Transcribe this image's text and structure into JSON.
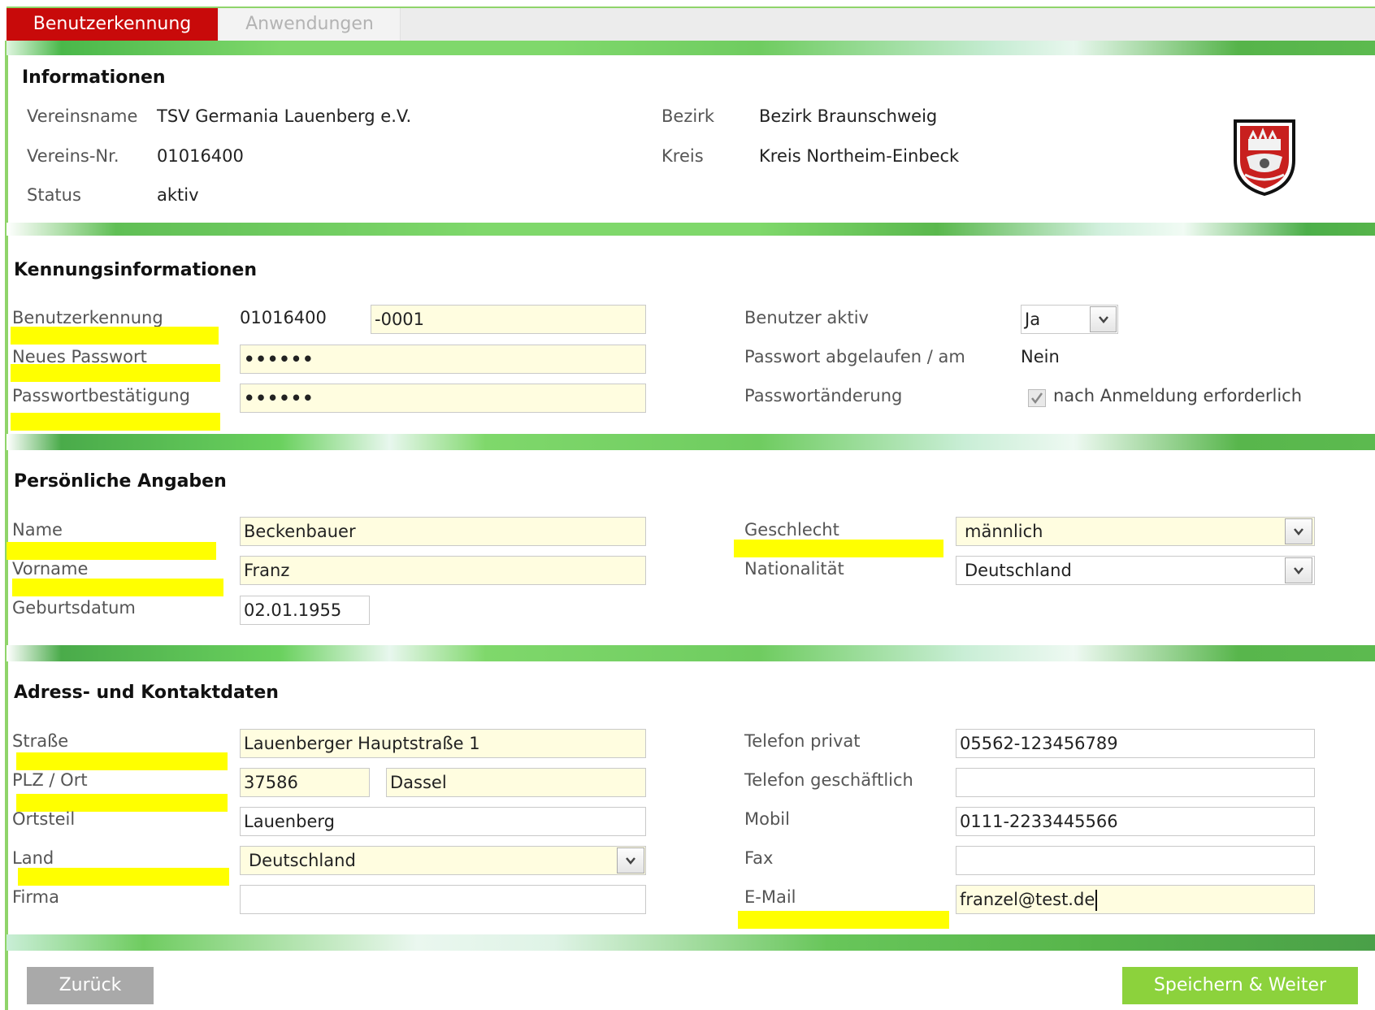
{
  "tabs": [
    {
      "label": "Benutzerkennung",
      "active": true
    },
    {
      "label": "Anwendungen",
      "active": false
    }
  ],
  "info": {
    "title": "Informationen",
    "vereinsname_label": "Vereinsname",
    "vereinsname": "TSV Germania Lauenberg e.V.",
    "vereinsnr_label": "Vereins-Nr.",
    "vereinsnr": "01016400",
    "status_label": "Status",
    "status": "aktiv",
    "bezirk_label": "Bezirk",
    "bezirk": "Bezirk Braunschweig",
    "kreis_label": "Kreis",
    "kreis": "Kreis Northeim-Einbeck"
  },
  "kennung": {
    "title": "Kennungsinformationen",
    "benutzerkennung_label": "Benutzerkennung",
    "benutzerkennung_prefix": "01016400",
    "benutzerkennung_suffix": "-0001",
    "passwort_label": "Neues Passwort",
    "passwort_value": "••••••",
    "bestaetigung_label": "Passwortbestätigung",
    "bestaetigung_value": "••••••",
    "benutzer_aktiv_label": "Benutzer aktiv",
    "benutzer_aktiv_value": "Ja",
    "abgelaufen_label": "Passwort abgelaufen / am",
    "abgelaufen_value": "Nein",
    "aenderung_label": "Passwortänderung",
    "aenderung_checkbox_label": "nach Anmeldung erforderlich",
    "aenderung_checked": true
  },
  "persoenlich": {
    "title": "Persönliche Angaben",
    "name_label": "Name",
    "name": "Beckenbauer",
    "vorname_label": "Vorname",
    "vorname": "Franz",
    "geburtsdatum_label": "Geburtsdatum",
    "geburtsdatum": "02.01.1955",
    "geschlecht_label": "Geschlecht",
    "geschlecht": "männlich",
    "nationalitaet_label": "Nationalität",
    "nationalitaet": "Deutschland"
  },
  "adresse": {
    "title": "Adress- und Kontaktdaten",
    "strasse_label": "Straße",
    "strasse": "Lauenberger Hauptstraße 1",
    "plzort_label": "PLZ / Ort",
    "plz": "37586",
    "ort": "Dassel",
    "ortsteil_label": "Ortsteil",
    "ortsteil": "Lauenberg",
    "land_label": "Land",
    "land": "Deutschland",
    "firma_label": "Firma",
    "firma": "",
    "tel_privat_label": "Telefon privat",
    "tel_privat": "05562-123456789",
    "tel_geschaeftlich_label": "Telefon geschäftlich",
    "tel_geschaeftlich": "",
    "mobil_label": "Mobil",
    "mobil": "0111-2233445566",
    "fax_label": "Fax",
    "fax": "",
    "email_label": "E-Mail",
    "email": "franzel@test.de"
  },
  "buttons": {
    "back": "Zurück",
    "save": "Speichern & Weiter"
  },
  "colors": {
    "tab_active": "#c80a0a",
    "band_green": "#7fd86b",
    "required_highlight": "#ffff00",
    "input_required_bg": "#fffde0",
    "save_button": "#8cd23c",
    "back_button": "#a9a9a9"
  }
}
